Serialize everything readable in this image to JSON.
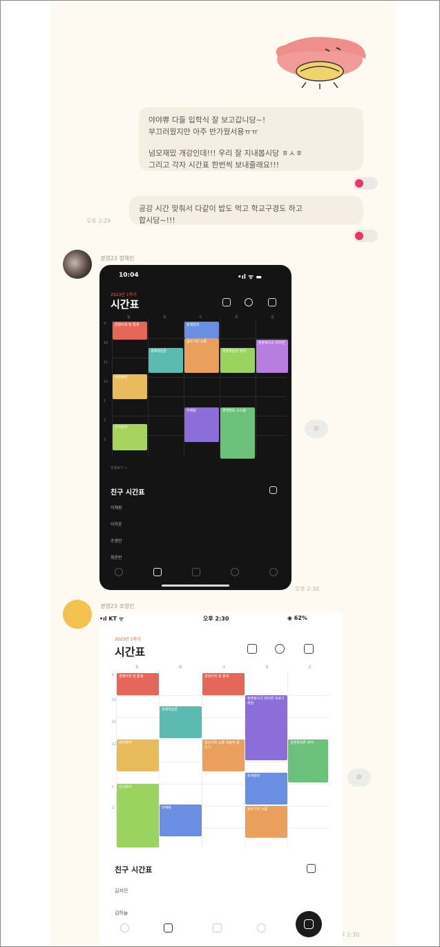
{
  "chat": {
    "messages": [
      {
        "lines": [
          "야야쀼 다들 입학식 잘 보고갑니당~!",
          "부끄러웠지만 아주 반가웠서용ㅠㅠ"
        ],
        "lines2": [
          "넘모재밌 개강인데!!! 우리 잘 지내봅시당 ㅎㅅㅎ",
          "그리고 각자 시간표 한번씩 보내줄래요!!!"
        ]
      },
      {
        "lines": [
          "공강 시간 맞춰서 다같이 밥도 먹고 학교구경도 하고",
          "합시당~!!!"
        ],
        "time": "오후 2:29"
      }
    ],
    "sender1": "경영23 정채린",
    "sender2": "경영23 조영민",
    "time_dark": "오후 2:30",
    "time_light": "오후 2:30"
  },
  "dark_phone": {
    "clock": "10:04",
    "signal": "•ıl ᯤ ▬",
    "semester": "2023년 1학기",
    "title": "시간표",
    "days": [
      "월",
      "화",
      "수",
      "목",
      "금"
    ],
    "hours": [
      "9",
      "10",
      "11",
      "12",
      "1",
      "2",
      "3"
    ],
    "more": "전체보기 >",
    "friends_title": "친구 시간표",
    "friends": [
      "이채원",
      "이하윤",
      "조영민",
      "최윤빈"
    ],
    "blocks": [
      {
        "label": "경영수학 및 통계",
        "color": "#e4675a"
      },
      {
        "label": "회계원리",
        "color": "#6b8fe0"
      },
      {
        "label": "글쓰기와 소통",
        "color": "#e8a05c"
      },
      {
        "label": "경제학원론",
        "color": "#5bbbb0"
      },
      {
        "label": "경영학원론 영어",
        "color": "#9bd35f"
      },
      {
        "label": "컴퓨팅사고 파이썬",
        "color": "#b77ee0"
      },
      {
        "label": "대학영어",
        "color": "#e8bc5c"
      },
      {
        "label": "마케팅",
        "color": "#8c6ed9"
      },
      {
        "label": "경영정보 시스템",
        "color": "#6cc17a"
      },
      {
        "label": "인사관리",
        "color": "#a7d35f"
      }
    ]
  },
  "light_phone": {
    "carrier": "•ıl KT ᯤ",
    "clock": "오후 2:30",
    "battery": "◉ 62%",
    "semester": "2023년 1학기",
    "title": "시간표",
    "days": [
      "월",
      "화",
      "수",
      "목",
      "금"
    ],
    "hours": [
      "9",
      "10",
      "11",
      "12",
      "1",
      "2"
    ],
    "friends_title": "친구 시간표",
    "friends": [
      "김지민",
      "김하늘"
    ],
    "blocks": [
      {
        "label": "경영수학 및 통계",
        "color": "#e4675a"
      },
      {
        "label": "경영수학 및 통계",
        "color": "#e4675a"
      },
      {
        "label": "경제학원론",
        "color": "#5bbbb0"
      },
      {
        "label": "컴퓨팅사고 파이썬 프로그래밍",
        "color": "#8c6ed9"
      },
      {
        "label": "대학영어",
        "color": "#e8bc5c"
      },
      {
        "label": "글쓰기와 소통 학술적 글쓰기",
        "color": "#e8a05c"
      },
      {
        "label": "경영학원론 영어",
        "color": "#6cc17a"
      },
      {
        "label": "회계원리",
        "color": "#6b8fe0"
      },
      {
        "label": "인사관리",
        "color": "#9bd35f"
      },
      {
        "label": "마케팅",
        "color": "#6b8fe0"
      },
      {
        "label": "글쓰기와 소통",
        "color": "#e8a05c"
      }
    ]
  }
}
